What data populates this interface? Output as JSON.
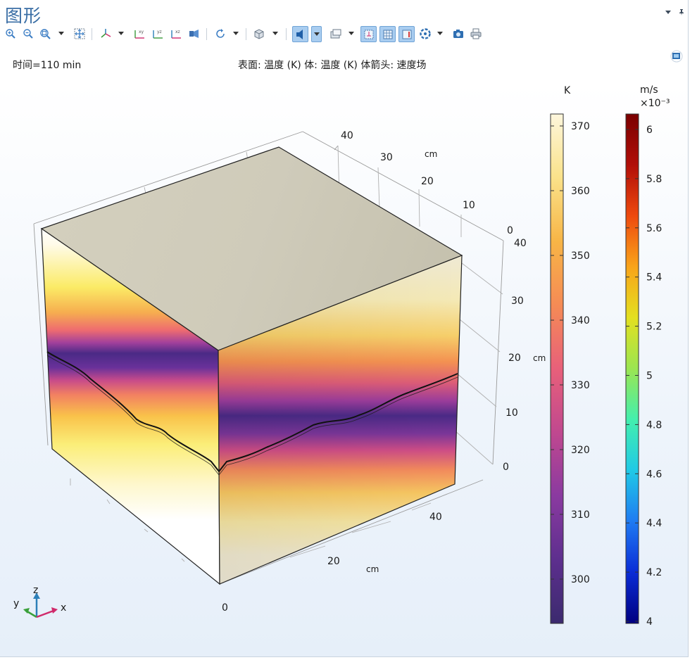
{
  "window": {
    "title": "图形"
  },
  "plot": {
    "time_label": "时间=110 min",
    "expression_label": "表面: 温度 (K)  体: 温度 (K)  体箭头: 速度场"
  },
  "axes": {
    "unit_label": "cm",
    "x_ticks": [
      "0",
      "20",
      "40"
    ],
    "y_ticks": [
      "0",
      "10",
      "20",
      "30",
      "40"
    ],
    "z_ticks": [
      "0",
      "10",
      "20",
      "30",
      "40"
    ]
  },
  "triad": {
    "x": "x",
    "y": "y",
    "z": "z"
  },
  "colorbars": [
    {
      "unit": "K",
      "ticks": [
        "300",
        "310",
        "320",
        "330",
        "340",
        "350",
        "360",
        "370"
      ],
      "colormap": [
        "#3b2a6e",
        "#5d2f8e",
        "#8a3aa0",
        "#c0488f",
        "#e8607a",
        "#f58b55",
        "#f7b546",
        "#fae28a",
        "#fdf6dc"
      ]
    },
    {
      "unit": "m/s",
      "multiplier": "×10⁻³",
      "ticks": [
        "4",
        "4.2",
        "4.4",
        "4.6",
        "4.8",
        "5",
        "5.2",
        "5.4",
        "5.6",
        "5.8",
        "6"
      ],
      "colormap": [
        "#000080",
        "#0a2cd6",
        "#1f7bf2",
        "#20c9e6",
        "#43efae",
        "#9be551",
        "#e3e020",
        "#f9a41a",
        "#ee4a0e",
        "#b10e08",
        "#7a0000"
      ]
    }
  ]
}
